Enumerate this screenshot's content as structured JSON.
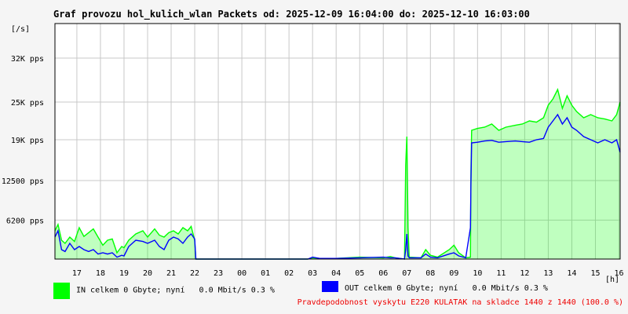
{
  "title": "Graf provozu hol_kulich_wlan Packets od: 2025-12-09 16:04:00 do: 2025-12-10 16:03:00",
  "legend": {
    "in": {
      "label": "IN celkem 0 Gbyte; nyní",
      "rate": "0.0 Mbit/s 0.3 %",
      "color": "#00ff00"
    },
    "out": {
      "label": "OUT celkem 0 Gbyte; nyní",
      "rate": "0.0 Mbit/s 0.3 %",
      "color": "#0000ff"
    }
  },
  "probability": "Pravdepodobnost vyskytu E220 KULATAK na skladce 1440 z 1440 (100.0 %)",
  "colors": {
    "in": "#00ff00",
    "out": "#0000ff",
    "text_alert": "#ee0000"
  },
  "chart_data": {
    "type": "area",
    "title": "Graf provozu hol_kulich_wlan Packets od: 2025-12-09 16:04:00 do: 2025-12-10 16:03:00",
    "ylabel": "[/s]",
    "xlabel": "[h]",
    "ylim": [
      0,
      37500
    ],
    "y_ticks": [
      {
        "value": 6200,
        "label": "6200 pps"
      },
      {
        "value": 12500,
        "label": "12500 pps"
      },
      {
        "value": 19000,
        "label": "19K pps"
      },
      {
        "value": 25000,
        "label": "25K pps"
      },
      {
        "value": 32000,
        "label": "32K pps"
      }
    ],
    "x_ticks": [
      "17",
      "18",
      "19",
      "20",
      "21",
      "22",
      "23",
      "00",
      "01",
      "02",
      "03",
      "04",
      "05",
      "06",
      "07",
      "08",
      "09",
      "10",
      "11",
      "12",
      "13",
      "14",
      "15",
      "16"
    ],
    "x_range_hours": [
      16.07,
      40.05
    ],
    "grid": true,
    "series": [
      {
        "name": "IN",
        "color": "#00ff00",
        "points": [
          [
            16.07,
            4500
          ],
          [
            16.2,
            5500
          ],
          [
            16.35,
            3000
          ],
          [
            16.5,
            2500
          ],
          [
            16.7,
            3500
          ],
          [
            16.9,
            2800
          ],
          [
            17.1,
            5000
          ],
          [
            17.3,
            3600
          ],
          [
            17.5,
            4200
          ],
          [
            17.7,
            4800
          ],
          [
            17.9,
            3500
          ],
          [
            18.1,
            2200
          ],
          [
            18.3,
            3000
          ],
          [
            18.5,
            3200
          ],
          [
            18.7,
            1000
          ],
          [
            18.9,
            2000
          ],
          [
            19.0,
            1800
          ],
          [
            19.2,
            3000
          ],
          [
            19.5,
            4000
          ],
          [
            19.8,
            4500
          ],
          [
            20.0,
            3500
          ],
          [
            20.3,
            4800
          ],
          [
            20.5,
            3800
          ],
          [
            20.7,
            3500
          ],
          [
            20.9,
            4200
          ],
          [
            21.1,
            4500
          ],
          [
            21.3,
            4000
          ],
          [
            21.5,
            5000
          ],
          [
            21.7,
            4500
          ],
          [
            21.85,
            5200
          ],
          [
            22.0,
            3000
          ],
          [
            22.05,
            0
          ],
          [
            24.0,
            0
          ],
          [
            26.8,
            0
          ],
          [
            27.0,
            200
          ],
          [
            27.3,
            100
          ],
          [
            28.0,
            100
          ],
          [
            29.0,
            300
          ],
          [
            30.0,
            200
          ],
          [
            30.3,
            400
          ],
          [
            30.5,
            200
          ],
          [
            30.9,
            0
          ],
          [
            30.95,
            15000
          ],
          [
            31.0,
            19500
          ],
          [
            31.05,
            5000
          ],
          [
            31.1,
            300
          ],
          [
            31.6,
            200
          ],
          [
            31.8,
            1500
          ],
          [
            32.0,
            600
          ],
          [
            32.3,
            300
          ],
          [
            32.8,
            1500
          ],
          [
            33.0,
            2200
          ],
          [
            33.2,
            1000
          ],
          [
            33.5,
            200
          ],
          [
            33.7,
            300
          ],
          [
            33.72,
            14000
          ],
          [
            33.75,
            20500
          ],
          [
            34.0,
            20800
          ],
          [
            34.3,
            21000
          ],
          [
            34.6,
            21500
          ],
          [
            34.9,
            20500
          ],
          [
            35.2,
            21000
          ],
          [
            35.6,
            21300
          ],
          [
            35.9,
            21500
          ],
          [
            36.2,
            22000
          ],
          [
            36.5,
            21800
          ],
          [
            36.8,
            22500
          ],
          [
            37.0,
            24500
          ],
          [
            37.2,
            25500
          ],
          [
            37.4,
            27000
          ],
          [
            37.6,
            24000
          ],
          [
            37.8,
            26000
          ],
          [
            38.0,
            24500
          ],
          [
            38.2,
            23500
          ],
          [
            38.5,
            22500
          ],
          [
            38.8,
            23000
          ],
          [
            39.1,
            22500
          ],
          [
            39.4,
            22300
          ],
          [
            39.7,
            22000
          ],
          [
            39.9,
            23000
          ],
          [
            40.05,
            25000
          ]
        ]
      },
      {
        "name": "OUT",
        "color": "#0000ff",
        "points": [
          [
            16.07,
            3500
          ],
          [
            16.2,
            4500
          ],
          [
            16.35,
            1500
          ],
          [
            16.5,
            1200
          ],
          [
            16.7,
            2500
          ],
          [
            16.9,
            1500
          ],
          [
            17.1,
            2000
          ],
          [
            17.3,
            1500
          ],
          [
            17.5,
            1200
          ],
          [
            17.7,
            1500
          ],
          [
            17.9,
            800
          ],
          [
            18.1,
            1000
          ],
          [
            18.3,
            800
          ],
          [
            18.5,
            1000
          ],
          [
            18.7,
            300
          ],
          [
            18.9,
            600
          ],
          [
            19.0,
            500
          ],
          [
            19.2,
            2000
          ],
          [
            19.5,
            3000
          ],
          [
            19.8,
            2800
          ],
          [
            20.0,
            2500
          ],
          [
            20.3,
            3000
          ],
          [
            20.5,
            2000
          ],
          [
            20.7,
            1500
          ],
          [
            20.9,
            3000
          ],
          [
            21.1,
            3500
          ],
          [
            21.3,
            3200
          ],
          [
            21.5,
            2500
          ],
          [
            21.7,
            3500
          ],
          [
            21.85,
            4000
          ],
          [
            22.0,
            3200
          ],
          [
            22.05,
            0
          ],
          [
            24.0,
            0
          ],
          [
            26.8,
            0
          ],
          [
            27.0,
            300
          ],
          [
            27.3,
            100
          ],
          [
            28.0,
            100
          ],
          [
            29.0,
            200
          ],
          [
            30.0,
            300
          ],
          [
            30.3,
            200
          ],
          [
            30.5,
            200
          ],
          [
            30.9,
            0
          ],
          [
            30.95,
            1500
          ],
          [
            31.0,
            4000
          ],
          [
            31.05,
            500
          ],
          [
            31.1,
            200
          ],
          [
            31.6,
            200
          ],
          [
            31.8,
            800
          ],
          [
            32.0,
            300
          ],
          [
            32.3,
            200
          ],
          [
            32.8,
            800
          ],
          [
            33.0,
            1000
          ],
          [
            33.2,
            500
          ],
          [
            33.5,
            200
          ],
          [
            33.7,
            5000
          ],
          [
            33.72,
            12000
          ],
          [
            33.75,
            18500
          ],
          [
            34.0,
            18600
          ],
          [
            34.3,
            18800
          ],
          [
            34.6,
            18900
          ],
          [
            34.9,
            18600
          ],
          [
            35.2,
            18700
          ],
          [
            35.6,
            18800
          ],
          [
            35.9,
            18700
          ],
          [
            36.2,
            18600
          ],
          [
            36.5,
            19000
          ],
          [
            36.8,
            19200
          ],
          [
            37.0,
            21000
          ],
          [
            37.2,
            22000
          ],
          [
            37.4,
            23000
          ],
          [
            37.6,
            21500
          ],
          [
            37.8,
            22500
          ],
          [
            38.0,
            21000
          ],
          [
            38.2,
            20500
          ],
          [
            38.5,
            19500
          ],
          [
            38.8,
            19000
          ],
          [
            39.1,
            18500
          ],
          [
            39.4,
            19000
          ],
          [
            39.7,
            18500
          ],
          [
            39.9,
            19000
          ],
          [
            40.05,
            17000
          ]
        ]
      }
    ]
  }
}
